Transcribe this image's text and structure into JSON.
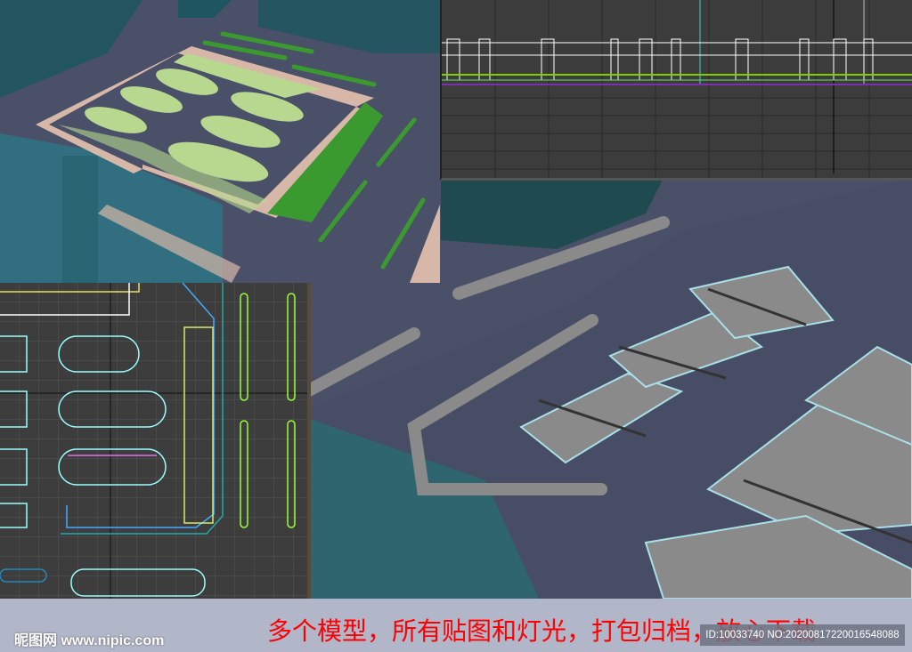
{
  "footer": {
    "logo_text": "昵图网 www.nipic.com",
    "slogan": "多个模型，所有贴图和灯光，打包归档，放心下载",
    "id_text": "ID:10033740 NO:20200817220016548088"
  },
  "colors": {
    "background": "#4a5068",
    "grass": "#3a9a30",
    "light_grass": "#b8d890",
    "slogan": "#ff0000"
  }
}
